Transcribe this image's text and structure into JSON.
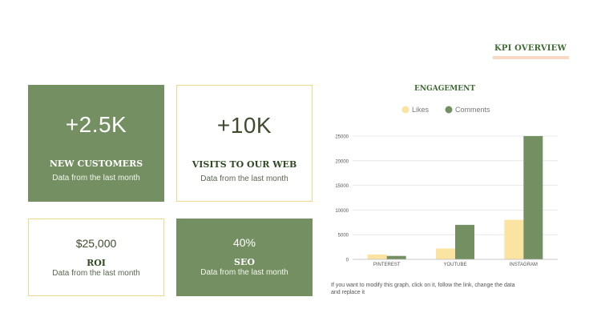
{
  "header": {
    "title": "KPI OVERVIEW"
  },
  "cards": [
    {
      "value": "+2.5K",
      "label": "NEW CUSTOMERS",
      "sub": "Data from the last month"
    },
    {
      "value": "+10K",
      "label": "VISITS TO OUR WEB",
      "sub": "Data from the last month"
    },
    {
      "value": "$25,000",
      "label": "ROI",
      "sub": "Data from the last month"
    },
    {
      "value": "40%",
      "label": "SEO",
      "sub": "Data from the last month"
    }
  ],
  "note": "If you want to modify this graph, click on it, follow the link, change the data and replace it",
  "colors": {
    "green": "#748f61",
    "yellow": "#fbe3a1",
    "accent_bar": "#f7d9c4",
    "title": "#3e6b34"
  },
  "chart_data": {
    "type": "bar",
    "title": "ENGAGEMENT",
    "categories": [
      "PINTEREST",
      "YOUTUBE",
      "INSTAGRAM"
    ],
    "series": [
      {
        "name": "Likes",
        "values": [
          1000,
          2200,
          8000
        ],
        "color": "#fbe3a1"
      },
      {
        "name": "Comments",
        "values": [
          700,
          7000,
          25000
        ],
        "color": "#748f61"
      }
    ],
    "ylim": [
      0,
      25000
    ],
    "yticks": [
      0,
      5000,
      10000,
      15000,
      20000,
      25000
    ],
    "xlabel": "",
    "ylabel": "",
    "legend": "top",
    "grid": true
  }
}
